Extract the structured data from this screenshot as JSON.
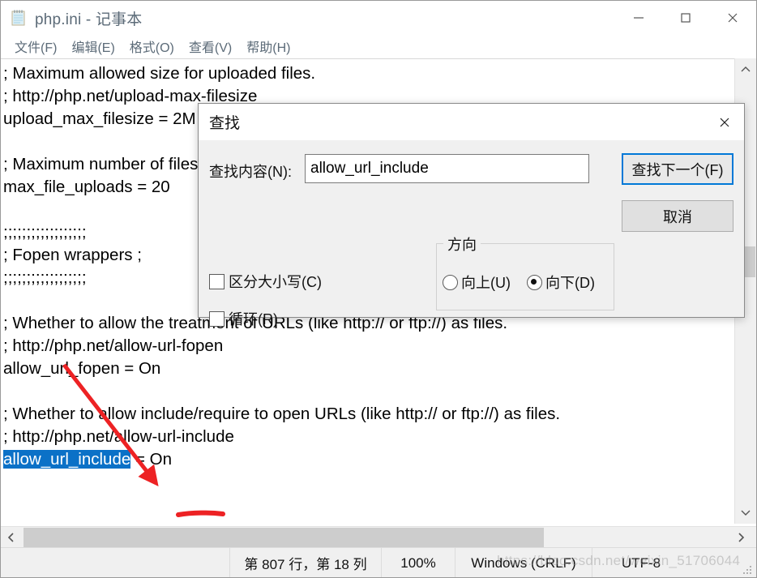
{
  "window": {
    "title": "php.ini - 记事本",
    "icon": "notepad-icon",
    "buttons": {
      "minimize": "—",
      "maximize": "▢",
      "close": "✕"
    }
  },
  "menubar": {
    "items": [
      {
        "label": "文件(F)",
        "name": "menu-file"
      },
      {
        "label": "编辑(E)",
        "name": "menu-edit"
      },
      {
        "label": "格式(O)",
        "name": "menu-format"
      },
      {
        "label": "查看(V)",
        "name": "menu-view"
      },
      {
        "label": "帮助(H)",
        "name": "menu-help"
      }
    ]
  },
  "editor": {
    "lines": [
      "; Maximum allowed size for uploaded files.",
      "; http://php.net/upload-max-filesize",
      "upload_max_filesize = 2M",
      "",
      "; Maximum number of files that can be uploaded via a single request",
      "max_file_uploads = 20",
      "",
      ";;;;;;;;;;;;;;;;;;",
      "; Fopen wrappers ;",
      ";;;;;;;;;;;;;;;;;;",
      "",
      "; Whether to allow the treatment of URLs (like http:// or ftp://) as files.",
      "; http://php.net/allow-url-fopen",
      "allow_url_fopen = On",
      "",
      "; Whether to allow include/require to open URLs (like http:// or ftp://) as files.",
      "; http://php.net/allow-url-include"
    ],
    "selected_line": {
      "selected_text": "allow_url_include",
      "rest_text": " = On"
    },
    "selection_color": "#0b71c7"
  },
  "dialog": {
    "title": "查找",
    "close_icon": "close-icon",
    "find_label": "查找内容(N):",
    "find_value": "allow_url_include",
    "find_placeholder": "",
    "find_next_label": "查找下一个(F)",
    "cancel_label": "取消",
    "direction": {
      "legend": "方向",
      "options": [
        {
          "label": "向上(U)",
          "selected": false
        },
        {
          "label": "向下(D)",
          "selected": true
        }
      ]
    },
    "checkboxes": [
      {
        "label": "区分大小写(C)",
        "checked": false
      },
      {
        "label": "循环(R)",
        "checked": false
      }
    ],
    "accent_color": "#0078d7"
  },
  "scrollbars": {
    "vertical": {
      "up": "⌃",
      "down": "⌄"
    },
    "horizontal": {
      "left": "❮",
      "right": "❯"
    }
  },
  "statusbar": {
    "position": "第 807 行，第 18 列",
    "zoom": "100%",
    "line_ending": "Windows (CRLF)",
    "encoding": "UTF-8"
  },
  "watermark": {
    "text": "https://blog.csdn.net/weixin_51706044"
  }
}
